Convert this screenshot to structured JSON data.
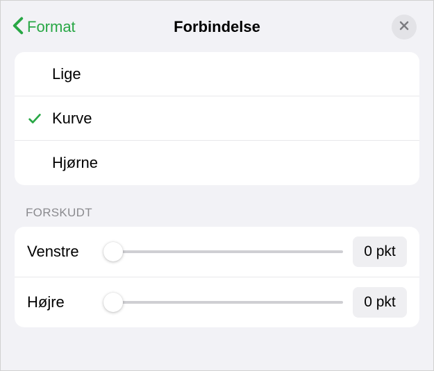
{
  "colors": {
    "accent": "#28a745",
    "close_bg": "#e3e3e7",
    "close_x": "#7c7c80"
  },
  "header": {
    "back_label": "Format",
    "title": "Forbindelse"
  },
  "connection_types": {
    "items": [
      {
        "label": "Lige",
        "selected": false
      },
      {
        "label": "Kurve",
        "selected": true
      },
      {
        "label": "Hjørne",
        "selected": false
      }
    ]
  },
  "offset": {
    "section_title": "Forskudt",
    "rows": [
      {
        "label": "Venstre",
        "value": "0 pkt",
        "position": 0
      },
      {
        "label": "Højre",
        "value": "0 pkt",
        "position": 0
      }
    ]
  }
}
